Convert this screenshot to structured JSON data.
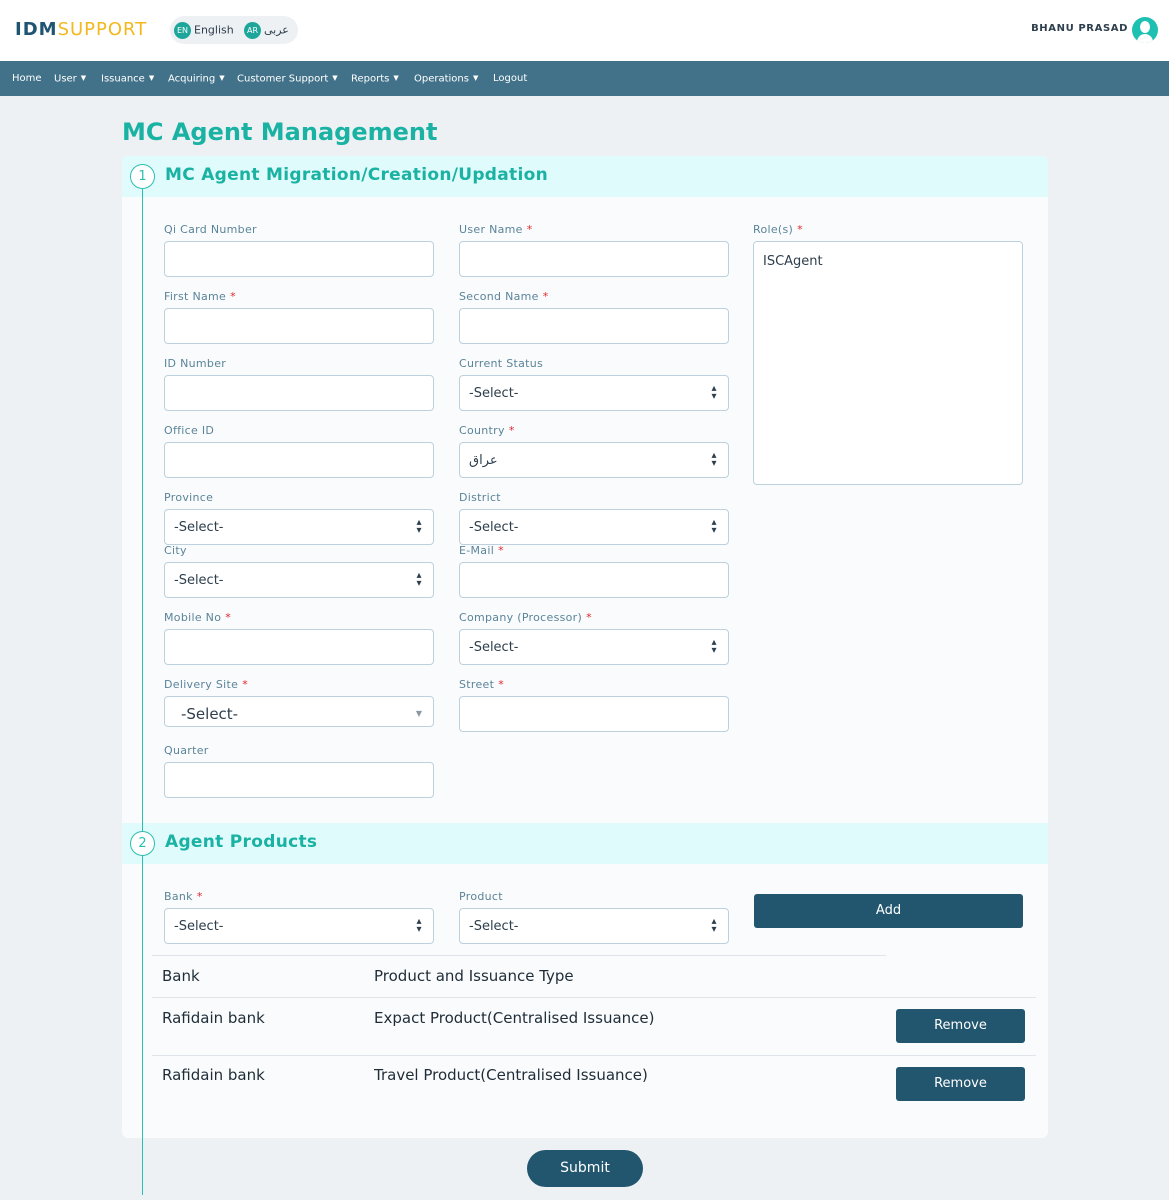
{
  "header": {
    "logo_part1": "IDM",
    "logo_part2": "SUPPORT",
    "lang_en_code": "EN",
    "lang_en_label": "English",
    "lang_ar_code": "AR",
    "lang_ar_label": "عربى",
    "user_name": "BHANU PRASAD"
  },
  "nav": [
    {
      "label": "Home"
    },
    {
      "label": "User"
    },
    {
      "label": "Issuance"
    },
    {
      "label": "Acquiring"
    },
    {
      "label": "Customer Support"
    },
    {
      "label": "Reports"
    },
    {
      "label": "Operations"
    },
    {
      "label": "Logout"
    }
  ],
  "page_title": "MC Agent Management",
  "section1": {
    "number": "1",
    "title": "MC Agent Migration/Creation/Updation",
    "fields": {
      "qi_card_number": {
        "label": "Qi Card Number",
        "value": ""
      },
      "user_name": {
        "label": "User Name",
        "value": ""
      },
      "roles": {
        "label": "Role(s)",
        "options": [
          "ISCAgent"
        ]
      },
      "first_name": {
        "label": "First Name",
        "value": ""
      },
      "second_name": {
        "label": "Second Name",
        "value": ""
      },
      "id_number": {
        "label": "ID Number",
        "value": ""
      },
      "current_status": {
        "label": "Current Status",
        "value": "-Select-"
      },
      "office_id": {
        "label": "Office ID",
        "value": ""
      },
      "country": {
        "label": "Country",
        "value": "عراق"
      },
      "province": {
        "label": "Province",
        "value": "-Select-"
      },
      "district": {
        "label": "District",
        "value": "-Select-"
      },
      "city": {
        "label": "City",
        "value": "-Select-"
      },
      "email": {
        "label": "E-Mail",
        "value": ""
      },
      "mobile_no": {
        "label": "Mobile No",
        "value": ""
      },
      "company": {
        "label": "Company (Processor)",
        "value": "-Select-"
      },
      "delivery_site": {
        "label": "Delivery Site",
        "value": "-Select-"
      },
      "street": {
        "label": "Street",
        "value": ""
      },
      "quarter": {
        "label": "Quarter",
        "value": ""
      }
    },
    "required_mark": "*"
  },
  "section2": {
    "number": "2",
    "title": "Agent Products",
    "bank": {
      "label": "Bank",
      "value": "-Select-"
    },
    "product": {
      "label": "Product",
      "value": "-Select-"
    },
    "add_label": "Add",
    "table": {
      "headers": [
        "Bank",
        "Product and Issuance Type"
      ],
      "rows": [
        {
          "bank": "Rafidain bank",
          "product": "Expact Product(Centralised Issuance)",
          "action": "Remove"
        },
        {
          "bank": "Rafidain bank",
          "product": "Travel Product(Centralised Issuance)",
          "action": "Remove"
        }
      ]
    }
  },
  "submit_label": "Submit",
  "colors": {
    "brand_dark": "#1f5573",
    "brand_yellow": "#f3b81c",
    "nav_bg": "#42728a",
    "accent_teal": "#1ab2a3",
    "button_bg": "#22566f",
    "required_red": "#e0292c"
  }
}
